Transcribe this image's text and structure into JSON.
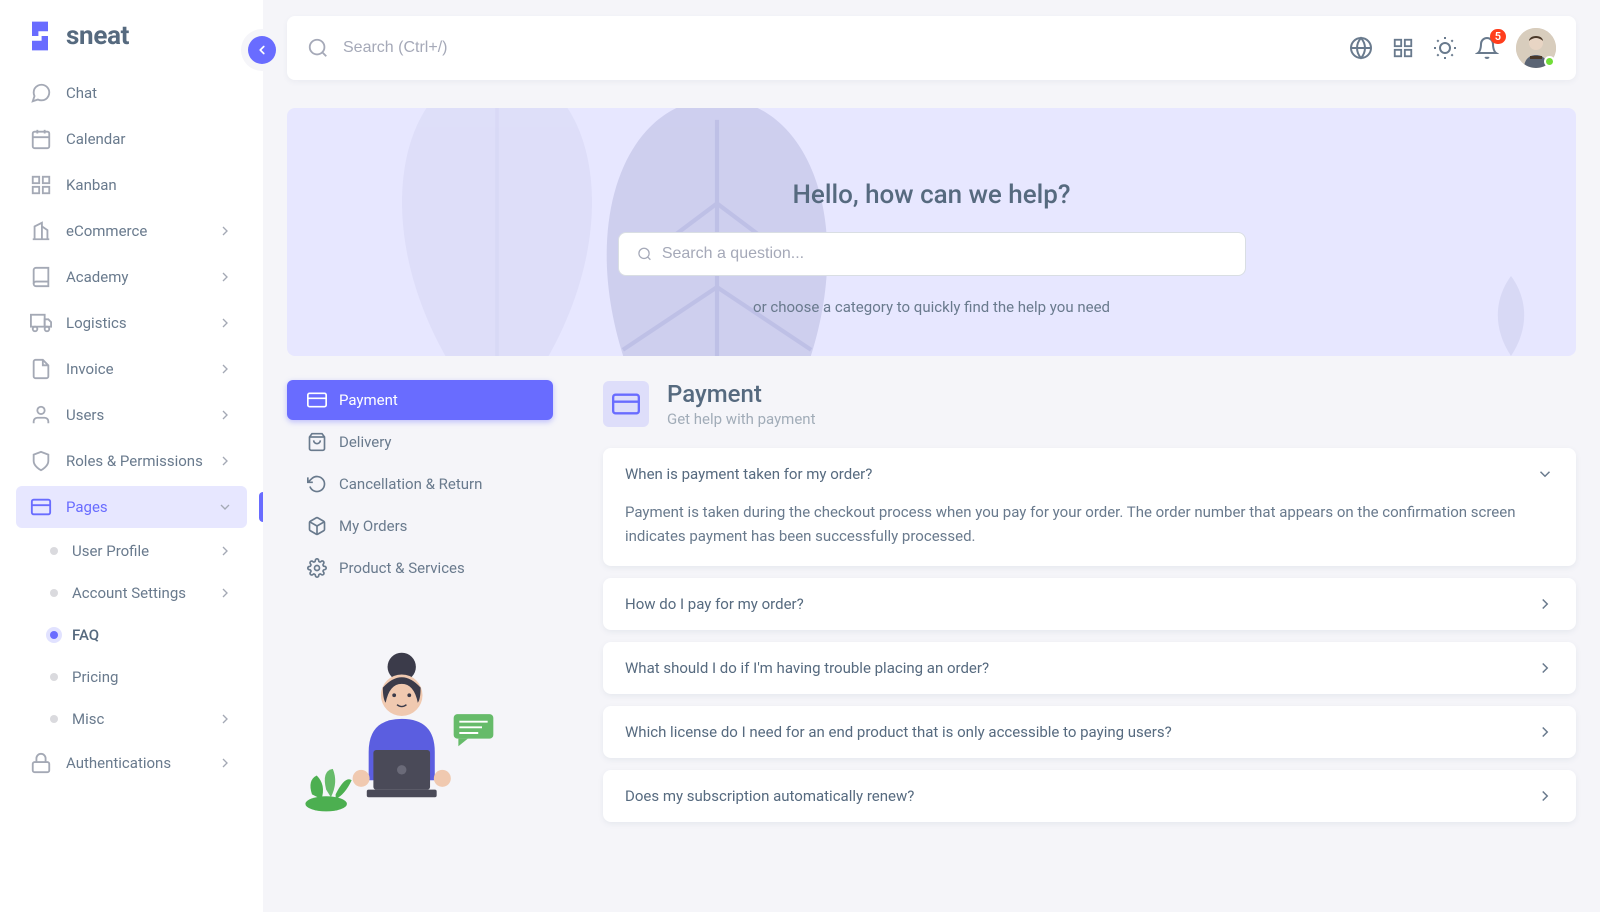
{
  "brand": {
    "name": "sneat"
  },
  "topbar": {
    "search_placeholder": "Search (Ctrl+/)",
    "notification_count": "5"
  },
  "sidebar": {
    "items": [
      {
        "label": "Chat",
        "icon": "chat"
      },
      {
        "label": "Calendar",
        "icon": "calendar"
      },
      {
        "label": "Kanban",
        "icon": "grid"
      },
      {
        "label": "eCommerce",
        "icon": "building",
        "chevron": true
      },
      {
        "label": "Academy",
        "icon": "book",
        "chevron": true
      },
      {
        "label": "Logistics",
        "icon": "truck",
        "chevron": true
      },
      {
        "label": "Invoice",
        "icon": "file",
        "chevron": true
      },
      {
        "label": "Users",
        "icon": "user",
        "chevron": true
      },
      {
        "label": "Roles & Permissions",
        "icon": "shield",
        "chevron": true
      },
      {
        "label": "Pages",
        "icon": "card",
        "chevron": true,
        "active": true
      },
      {
        "label": "Authentications",
        "icon": "lock",
        "chevron": true
      }
    ],
    "pages_children": [
      {
        "label": "User Profile",
        "chevron": true
      },
      {
        "label": "Account Settings",
        "chevron": true
      },
      {
        "label": "FAQ",
        "current": true
      },
      {
        "label": "Pricing"
      },
      {
        "label": "Misc",
        "chevron": true
      }
    ]
  },
  "hero": {
    "title": "Hello, how can we help?",
    "search_placeholder": "Search a question...",
    "subtitle": "or choose a category to quickly find the help you need"
  },
  "tabs": [
    {
      "label": "Payment",
      "icon": "card",
      "active": true
    },
    {
      "label": "Delivery",
      "icon": "bag"
    },
    {
      "label": "Cancellation & Return",
      "icon": "refresh"
    },
    {
      "label": "My Orders",
      "icon": "box"
    },
    {
      "label": "Product & Services",
      "icon": "gear"
    }
  ],
  "section": {
    "title": "Payment",
    "subtitle": "Get help with payment"
  },
  "faq": [
    {
      "q": "When is payment taken for my order?",
      "a": "Payment is taken during the checkout process when you pay for your order. The order number that appears on the confirmation screen indicates payment has been successfully processed.",
      "open": true
    },
    {
      "q": "How do I pay for my order?"
    },
    {
      "q": "What should I do if I'm having trouble placing an order?"
    },
    {
      "q": "Which license do I need for an end product that is only accessible to paying users?"
    },
    {
      "q": "Does my subscription automatically renew?"
    }
  ],
  "colors": {
    "primary": "#696cff",
    "primary_light": "#e7e7ff",
    "text": "#566a7f",
    "muted": "#697a8d"
  }
}
